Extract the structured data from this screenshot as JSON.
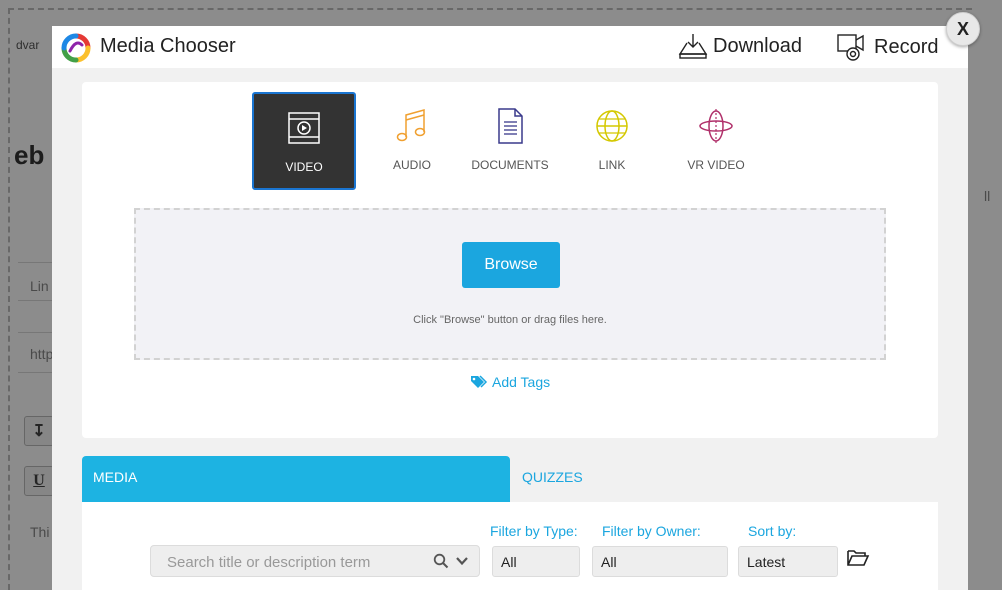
{
  "background": {
    "fragments": [
      "dvar",
      "eb",
      "Lin",
      "http",
      "U",
      "Thi",
      "ll"
    ]
  },
  "modal": {
    "title": "Media Chooser",
    "download_label": "Download",
    "record_label": "Record",
    "close_label": "X"
  },
  "media_types": [
    {
      "label": "VIDEO",
      "icon": "video-icon",
      "active": true
    },
    {
      "label": "AUDIO",
      "icon": "music-note-icon",
      "active": false
    },
    {
      "label": "DOCUMENTS",
      "icon": "document-icon",
      "active": false
    },
    {
      "label": "LINK",
      "icon": "globe-icon",
      "active": false
    },
    {
      "label": "VR VIDEO",
      "icon": "vr-icon",
      "active": false
    }
  ],
  "upload": {
    "browse_label": "Browse",
    "hint": "Click \"Browse\" button or drag files here.",
    "add_tags_label": "Add Tags"
  },
  "tabs": {
    "media": "MEDIA",
    "quizzes": "QUIZZES"
  },
  "filters": {
    "search_placeholder": "Search title or description term",
    "type_label": "Filter by Type:",
    "type_value": "All",
    "owner_label": "Filter by Owner:",
    "owner_value": "All",
    "sort_label": "Sort by:",
    "sort_value": "Latest"
  },
  "colors": {
    "accent": "#1BA6DF",
    "active_tab_bg": "#333333",
    "active_tab_border": "#1A75D1",
    "audio_icon": "#F0A030",
    "document_icon": "#3A3A8C",
    "link_icon": "#D4C800",
    "vr_icon": "#B0306A"
  }
}
